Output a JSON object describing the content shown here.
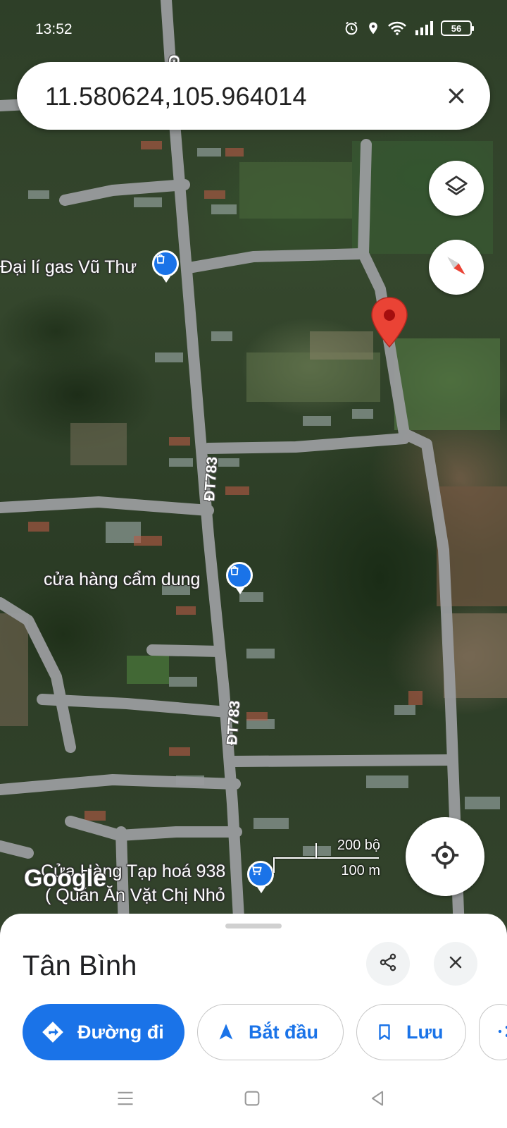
{
  "status_bar": {
    "time": "13:52",
    "battery": "56",
    "icons": [
      "alarm-icon",
      "location-icon",
      "wifi-icon",
      "signal-icon",
      "battery-icon"
    ]
  },
  "search": {
    "value": "11.580624,105.964014",
    "clear_icon": "close-icon"
  },
  "map": {
    "type": "satellite",
    "places": [
      {
        "name": "Đại lí gas Vũ Thư",
        "icon": "shopping-bag-icon"
      },
      {
        "name": "cửa hàng cẩm dung",
        "icon": "shopping-bag-icon"
      },
      {
        "name": "Cửa Hàng Tạp hoá 938",
        "name_line2": "( Quán Ăn Vặt Chị Nhỏ",
        "icon": "shopping-cart-icon"
      }
    ],
    "roads": [
      "ĐT783",
      "ĐT783",
      "Đ"
    ],
    "attribution": "Google",
    "scale": {
      "feet": "200 bộ",
      "meters": "100 m"
    },
    "pin_color": "#ea4335",
    "controls": [
      "layers-icon",
      "compass-icon",
      "my-location-icon"
    ]
  },
  "sheet": {
    "title": "Tân Bình",
    "share_icon": "share-icon",
    "close_icon": "close-icon",
    "actions": {
      "directions": "Đường đi",
      "start": "Bắt đầu",
      "save": "Lưu"
    },
    "accent_color": "#1a73e8"
  },
  "nav_bar": {
    "items": [
      "menu-icon",
      "home-icon",
      "back-icon"
    ]
  }
}
